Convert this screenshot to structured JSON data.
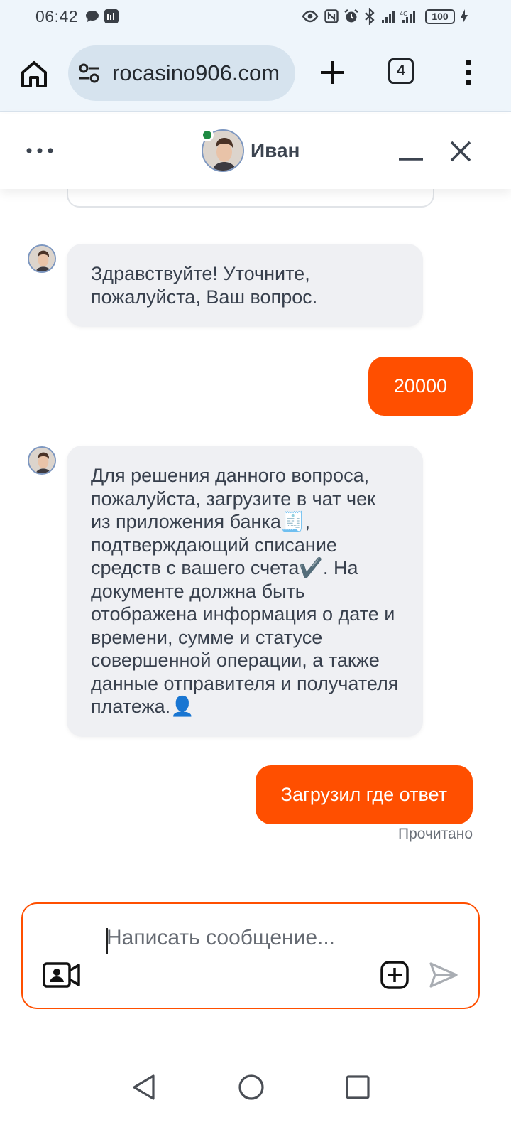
{
  "status_bar": {
    "time": "06:42",
    "battery": "100"
  },
  "browser": {
    "url": "rocasino906.com",
    "tab_count": "4"
  },
  "chat": {
    "agent_name": "Иван",
    "messages": [
      {
        "from": "agent",
        "text": "Здравствуйте! Уточните, пожалуйста, Ваш вопрос."
      },
      {
        "from": "user",
        "text": "20000"
      },
      {
        "from": "agent",
        "text": "Для решения данного вопроса, пожалуйста, загрузите в чат чек из приложения банка🧾, подтверждающий списание средств с вашего счета✔️. На документе должна быть отображена информация о дате и времени, сумме и статусе совершенной операции, а также данные отправителя и получателя платежа.👤"
      },
      {
        "from": "user",
        "text": "Загрузил где ответ"
      }
    ],
    "read_status": "Прочитано"
  },
  "composer": {
    "placeholder": "Написать сообщение..."
  },
  "colors": {
    "accent": "#ff4f00",
    "agent_bubble": "#eff0f3",
    "online": "#1e8a42"
  }
}
